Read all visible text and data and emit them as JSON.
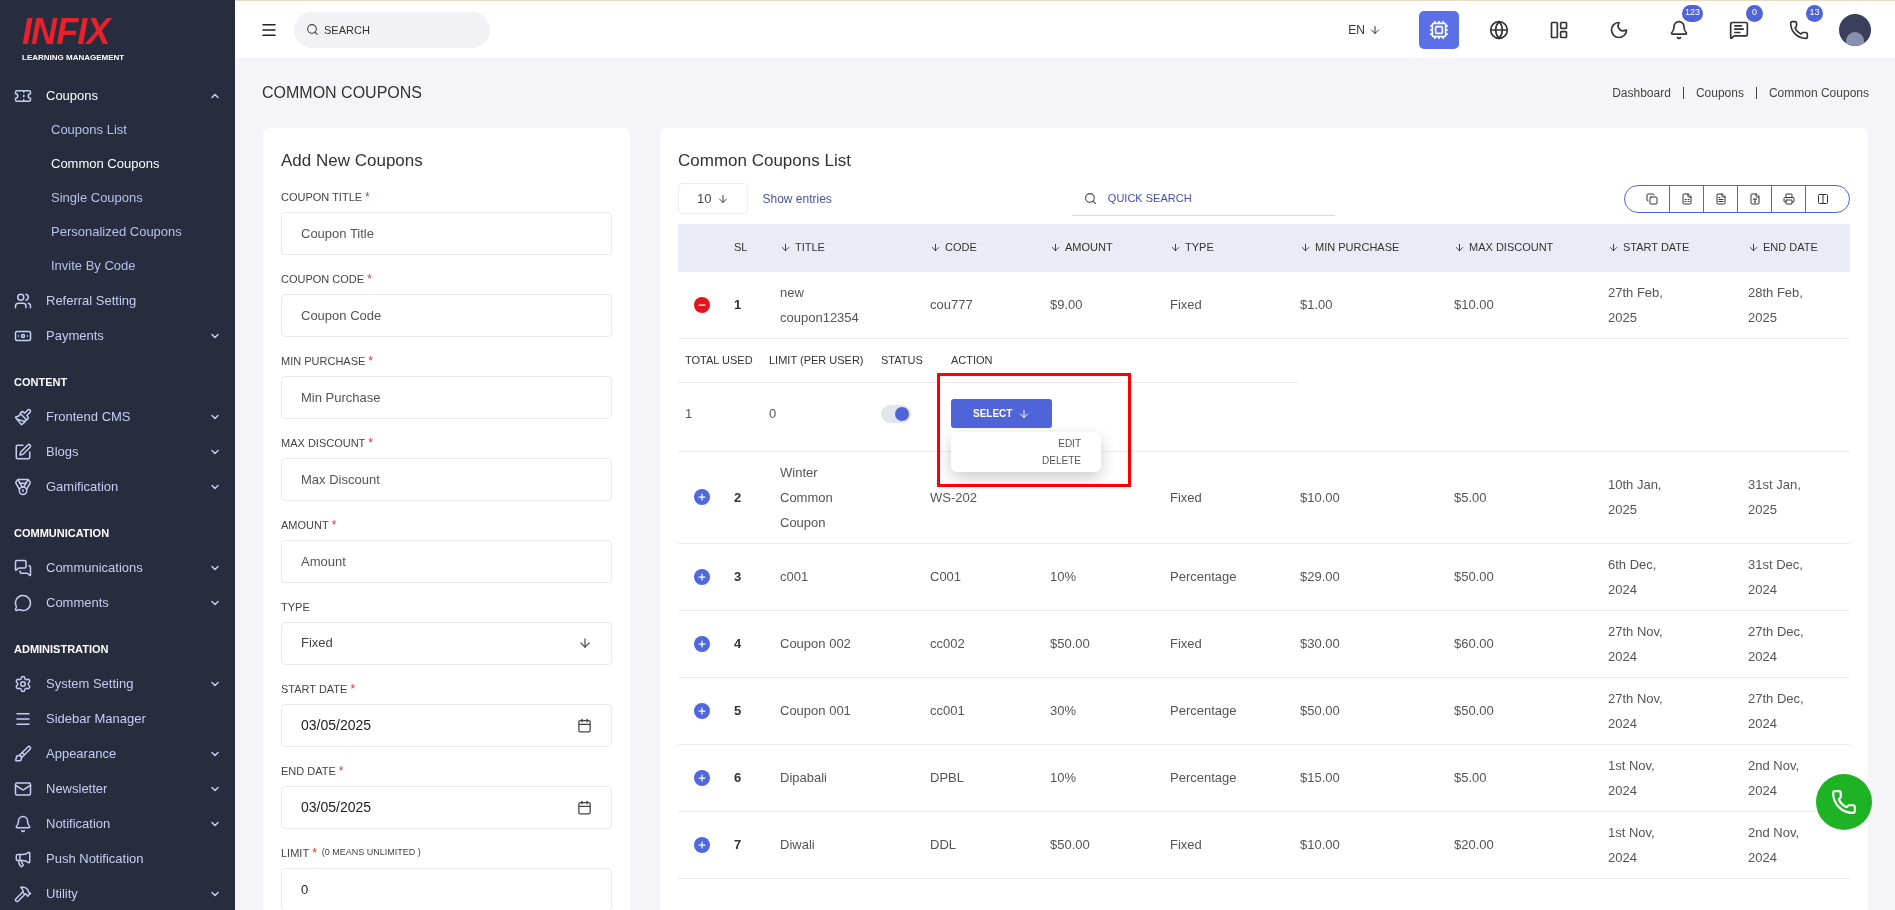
{
  "logo": {
    "mark": "INFIX",
    "subtitle": "LEARNING MANAGEMENT"
  },
  "sidebar": {
    "items": [
      {
        "kind": "item",
        "label": "Coupons",
        "expanded": true,
        "children": [
          {
            "label": "Coupons List",
            "selected": false
          },
          {
            "label": "Common Coupons",
            "selected": true
          },
          {
            "label": "Single Coupons",
            "selected": false
          },
          {
            "label": "Personalized Coupons",
            "selected": false
          },
          {
            "label": "Invite By Code",
            "selected": false
          }
        ]
      },
      {
        "kind": "item",
        "label": "Referral Setting"
      },
      {
        "kind": "item",
        "label": "Payments",
        "expanded": false
      },
      {
        "kind": "section",
        "label": "CONTENT"
      },
      {
        "kind": "item",
        "label": "Frontend CMS",
        "expanded": false
      },
      {
        "kind": "item",
        "label": "Blogs",
        "expanded": false
      },
      {
        "kind": "item",
        "label": "Gamification",
        "expanded": false
      },
      {
        "kind": "section",
        "label": "COMMUNICATION"
      },
      {
        "kind": "item",
        "label": "Communications",
        "expanded": false
      },
      {
        "kind": "item",
        "label": "Comments",
        "expanded": false
      },
      {
        "kind": "section",
        "label": "ADMINISTRATION"
      },
      {
        "kind": "item",
        "label": "System Setting",
        "expanded": false
      },
      {
        "kind": "item",
        "label": "Sidebar Manager"
      },
      {
        "kind": "item",
        "label": "Appearance",
        "expanded": false
      },
      {
        "kind": "item",
        "label": "Newsletter",
        "expanded": false
      },
      {
        "kind": "item",
        "label": "Notification",
        "expanded": false
      },
      {
        "kind": "item",
        "label": "Push Notification"
      },
      {
        "kind": "item",
        "label": "Utility",
        "expanded": false
      }
    ]
  },
  "topbar": {
    "search_placeholder": "SEARCH",
    "language": "EN",
    "icons": [
      {
        "selected": true
      },
      {
        "selected": false
      },
      {
        "selected": false
      },
      {
        "selected": false
      },
      {
        "selected": false,
        "badge": "123"
      },
      {
        "selected": false,
        "badge": "0"
      },
      {
        "selected": false,
        "badge": "13"
      }
    ]
  },
  "page_title": "COMMON COUPONS",
  "breadcrumbs": [
    "Dashboard",
    "Coupons",
    "Common Coupons"
  ],
  "form": {
    "title": "Add New Coupons",
    "fields": [
      {
        "kind": "text",
        "label": "COUPON TITLE",
        "required_mark": "*",
        "placeholder": "Coupon Title"
      },
      {
        "kind": "text",
        "label": "COUPON CODE",
        "required_mark": "*",
        "placeholder": "Coupon Code"
      },
      {
        "kind": "text",
        "label": "MIN PURCHASE",
        "required_mark": "*",
        "placeholder": "Min Purchase"
      },
      {
        "kind": "text",
        "label": "MAX DISCOUNT",
        "required_mark": "*",
        "placeholder": "Max Discount"
      },
      {
        "kind": "text",
        "label": "AMOUNT",
        "required_mark": "*",
        "placeholder": "Amount"
      },
      {
        "kind": "select",
        "label": "TYPE",
        "value": "Fixed"
      },
      {
        "kind": "date",
        "label": "START DATE",
        "required_mark": "*",
        "value": "03/05/2025"
      },
      {
        "kind": "date",
        "label": "END DATE",
        "required_mark": "*",
        "value": "03/05/2025"
      },
      {
        "kind": "text",
        "label": "LIMIT",
        "required_mark": "*",
        "note": "(0 MEANS UNLIMITED )",
        "value": "0"
      }
    ]
  },
  "list": {
    "title": "Common Coupons List",
    "page_size": "10",
    "show_entries": "Show entries",
    "search_placeholder": "QUICK SEARCH",
    "columns": [
      {
        "label": "SL",
        "sort": false
      },
      {
        "label": "TITLE",
        "sort": true
      },
      {
        "label": "CODE",
        "sort": true
      },
      {
        "label": "AMOUNT",
        "sort": true
      },
      {
        "label": "TYPE",
        "sort": true
      },
      {
        "label": "MIN PURCHASE",
        "sort": true
      },
      {
        "label": "MAX DISCOUNT",
        "sort": true
      },
      {
        "label": "START DATE",
        "sort": true
      },
      {
        "label": "END DATE",
        "sort": true
      }
    ],
    "detail_columns": [
      "TOTAL USED",
      "LIMIT (PER USER)",
      "STATUS",
      "ACTION"
    ],
    "rows": [
      {
        "expanded": true,
        "sl": "1",
        "title": "new coupon12354",
        "code": "cou777",
        "amount": "$9.00",
        "type": "Fixed",
        "min_purchase": "$1.00",
        "max_discount": "$10.00",
        "start_date": "27th Feb, 2025",
        "end_date": "28th Feb, 2025",
        "detail": {
          "total_used": "1",
          "limit": "0",
          "status_on": true,
          "action": "SELECT",
          "menu": [
            "EDIT",
            "DELETE"
          ]
        }
      },
      {
        "expanded": false,
        "sl": "2",
        "title": "Winter Common Coupon",
        "code": "WS-202",
        "type": "Fixed",
        "min_purchase": "$10.00",
        "max_discount": "$5.00",
        "start_date": "10th Jan, 2025",
        "end_date": "31st Jan, 2025"
      },
      {
        "expanded": false,
        "sl": "3",
        "title": "c001",
        "code": "C001",
        "amount": "10%",
        "type": "Percentage",
        "min_purchase": "$29.00",
        "max_discount": "$50.00",
        "start_date": "6th Dec, 2024",
        "end_date": "31st Dec, 2024"
      },
      {
        "expanded": false,
        "sl": "4",
        "title": "Coupon 002",
        "code": "cc002",
        "amount": "$50.00",
        "type": "Fixed",
        "min_purchase": "$30.00",
        "max_discount": "$60.00",
        "start_date": "27th Nov, 2024",
        "end_date": "27th Dec, 2024"
      },
      {
        "expanded": false,
        "sl": "5",
        "title": "Coupon 001",
        "code": "cc001",
        "amount": "30%",
        "type": "Percentage",
        "min_purchase": "$50.00",
        "max_discount": "$50.00",
        "start_date": "27th Nov, 2024",
        "end_date": "27th Dec, 2024"
      },
      {
        "expanded": false,
        "sl": "6",
        "title": "Dipabali",
        "code": "DPBL",
        "amount": "10%",
        "type": "Percentage",
        "min_purchase": "$15.00",
        "max_discount": "$5.00",
        "start_date": "1st Nov, 2024",
        "end_date": "2nd Nov, 2024"
      },
      {
        "expanded": false,
        "sl": "7",
        "title": "Diwali",
        "code": "DDL",
        "amount": "$50.00",
        "type": "Fixed",
        "min_purchase": "$10.00",
        "max_discount": "$20.00",
        "start_date": "1st Nov, 2024",
        "end_date": "2nd Nov, 2024"
      }
    ]
  }
}
